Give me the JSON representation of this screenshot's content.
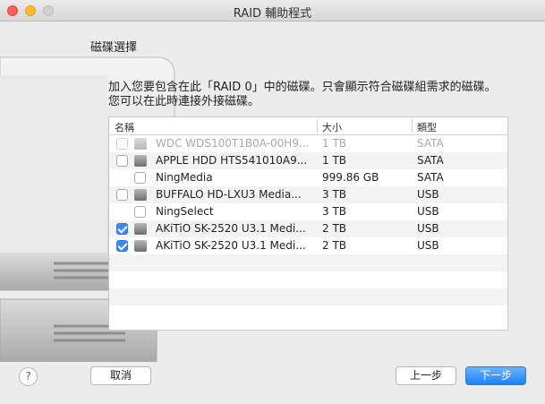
{
  "window": {
    "title": "RAID 輔助程式"
  },
  "panel": {
    "title": "磁碟選擇",
    "description_line1": "加入您要包含在此「RAID 0」中的磁碟。只會顯示符合磁碟組需求的磁碟。",
    "description_line2": "您可以在此時連接外接磁碟。"
  },
  "table": {
    "headers": {
      "name": "名稱",
      "size": "大小",
      "type": "類型"
    },
    "rows": [
      {
        "name": "WDC WDS100T1B0A-00H9...",
        "size": "1 TB",
        "type": "SATA",
        "checked": false,
        "enabled": false,
        "checkbox": true,
        "icon": "disk-icon"
      },
      {
        "name": "APPLE HDD HTS541010A9...",
        "size": "1 TB",
        "type": "SATA",
        "checked": false,
        "enabled": true,
        "checkbox": true,
        "icon": "disk-icon"
      },
      {
        "name": "NingMedia",
        "size": "999.86 GB",
        "type": "SATA",
        "checked": false,
        "enabled": true,
        "checkbox": true,
        "icon": "none"
      },
      {
        "name": "BUFFALO HD-LXU3 Media...",
        "size": "3 TB",
        "type": "USB",
        "checked": false,
        "enabled": true,
        "checkbox": true,
        "icon": "disk-icon"
      },
      {
        "name": "NingSelect",
        "size": "3 TB",
        "type": "USB",
        "checked": false,
        "enabled": true,
        "checkbox": true,
        "icon": "none"
      },
      {
        "name": "AKiTiO SK-2520 U3.1 Medi...",
        "size": "2 TB",
        "type": "USB",
        "checked": true,
        "enabled": true,
        "checkbox": true,
        "icon": "disk-icon"
      },
      {
        "name": "AKiTiO SK-2520 U3.1 Medi...",
        "size": "2 TB",
        "type": "USB",
        "checked": true,
        "enabled": true,
        "checkbox": true,
        "icon": "disk-icon"
      }
    ]
  },
  "buttons": {
    "help": "?",
    "cancel": "取消",
    "back": "上一步",
    "next": "下一步"
  },
  "colors": {
    "accent": "#1a82fb",
    "checkbox_checked": "#3b88f5"
  }
}
